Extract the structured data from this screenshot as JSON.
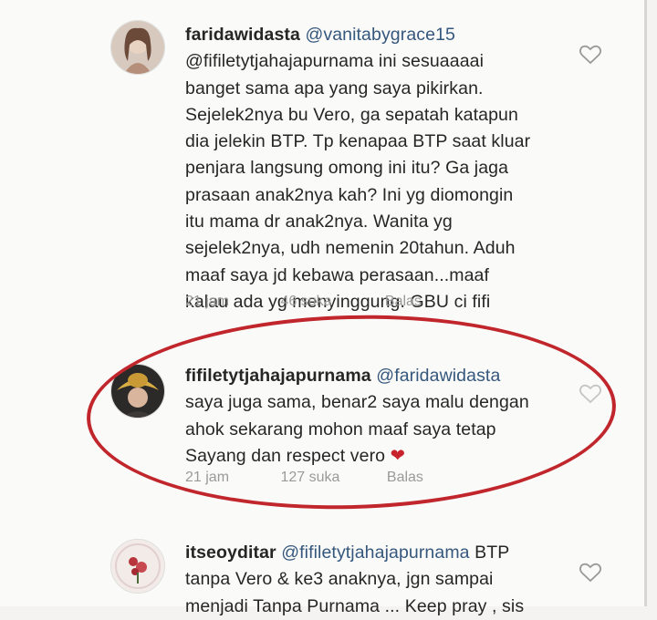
{
  "comments": [
    {
      "username": "faridawidasta",
      "reply_to": "@vanitabygrace15",
      "lines": [
        "@fifiletytjahajapurnama ini sesuaaaai",
        "banget sama apa yang saya pikirkan.",
        "Sejelek2nya bu Vero, ga sepatah katapun",
        "dia jelekin BTP. Tp kenapaa BTP saat kluar",
        "penjara langsung omong ini itu? Ga jaga",
        "prasaan anak2nya kah? Ini yg diomongin",
        "itu mama dr anak2nya. Wanita yg",
        "sejelek2nya, udh nemenin 20tahun. Aduh",
        "maaf saya jd kebawa perasaan...maaf",
        "kalau ada yg menyinggung. GBU ci fifi"
      ],
      "time": "21 jam",
      "likes": "46 suka",
      "reply_label": "Balas"
    },
    {
      "username": "fifiletytjahajapurnama",
      "reply_to": "@faridawidasta",
      "lines": [
        "saya juga sama, benar2 saya malu dengan",
        "ahok sekarang mohon maaf saya tetap",
        "Sayang dan respect vero"
      ],
      "emoji": "❤",
      "time": "21 jam",
      "likes": "127 suka",
      "reply_label": "Balas"
    },
    {
      "username": "itseoyditar",
      "reply_to": "@fifiletytjahajapurnama",
      "first_line_tail": "BTP",
      "lines": [
        "tanpa Vero & ke3 anaknya, jgn sampai",
        "menjadi Tanpa Purnama ... Keep pray , sis"
      ]
    }
  ],
  "colors": {
    "mention": "#35577d",
    "highlight": "#c0262b",
    "heart": "#c8232c",
    "meta": "#9a9a9a"
  },
  "icons": [
    "heart-outline-icon"
  ]
}
